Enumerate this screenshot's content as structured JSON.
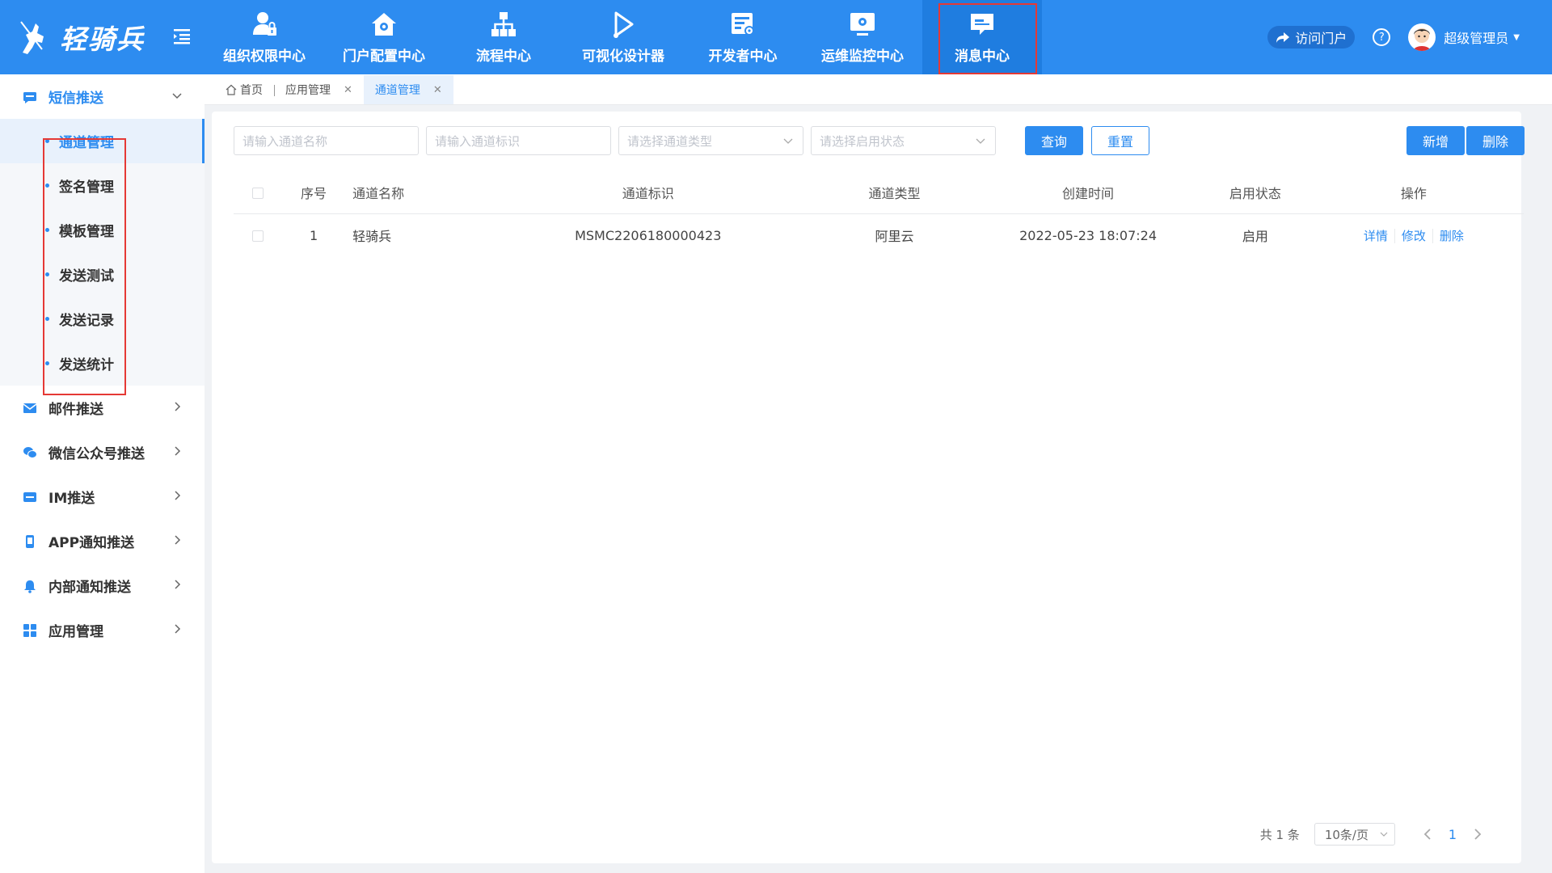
{
  "app": {
    "logo_text": "轻骑兵"
  },
  "nav": [
    {
      "label": "组织权限中心",
      "icon": "user-lock-icon"
    },
    {
      "label": "门户配置中心",
      "icon": "home-gear-icon"
    },
    {
      "label": "流程中心",
      "icon": "org-chart-icon"
    },
    {
      "label": "可视化设计器",
      "icon": "play-design-icon"
    },
    {
      "label": "开发者中心",
      "icon": "dev-doc-icon"
    },
    {
      "label": "运维监控中心",
      "icon": "monitor-icon"
    },
    {
      "label": "消息中心",
      "icon": "message-icon"
    }
  ],
  "header": {
    "portal_label": "访问门户",
    "help_symbol": "?",
    "user_name": "超级管理员"
  },
  "sidebar": {
    "groups": [
      {
        "label": "短信推送",
        "icon": "sms-icon",
        "expanded": true,
        "items": [
          "通道管理",
          "签名管理",
          "模板管理",
          "发送测试",
          "发送记录",
          "发送统计"
        ],
        "active_item": "通道管理"
      },
      {
        "label": "邮件推送",
        "icon": "mail-icon"
      },
      {
        "label": "微信公众号推送",
        "icon": "wechat-icon"
      },
      {
        "label": "IM推送",
        "icon": "im-icon"
      },
      {
        "label": "APP通知推送",
        "icon": "app-icon"
      },
      {
        "label": "内部通知推送",
        "icon": "bell-icon"
      },
      {
        "label": "应用管理",
        "icon": "grid-icon"
      }
    ]
  },
  "tabs": [
    {
      "label": "首页",
      "closable": false
    },
    {
      "label": "应用管理",
      "closable": true
    },
    {
      "label": "通道管理",
      "closable": true,
      "active": true
    }
  ],
  "filters": {
    "name_placeholder": "请输入通道名称",
    "flag_placeholder": "请输入通道标识",
    "type_placeholder": "请选择通道类型",
    "status_placeholder": "请选择启用状态",
    "query_label": "查询",
    "reset_label": "重置",
    "add_label": "新增",
    "delete_label": "删除"
  },
  "table": {
    "columns": [
      "序号",
      "通道名称",
      "通道标识",
      "通道类型",
      "创建时间",
      "启用状态",
      "操作"
    ],
    "rows": [
      {
        "no": "1",
        "name": "轻骑兵",
        "flag": "MSMC2206180000423",
        "type": "阿里云",
        "created": "2022-05-23 18:07:24",
        "status": "启用",
        "ops": [
          "详情",
          "修改",
          "删除"
        ]
      }
    ]
  },
  "pagination": {
    "total_text": "共 1 条",
    "page_size": "10条/页",
    "current_page": "1"
  },
  "colors": {
    "primary": "#2d8cf0",
    "highlight_border": "#e53935"
  }
}
